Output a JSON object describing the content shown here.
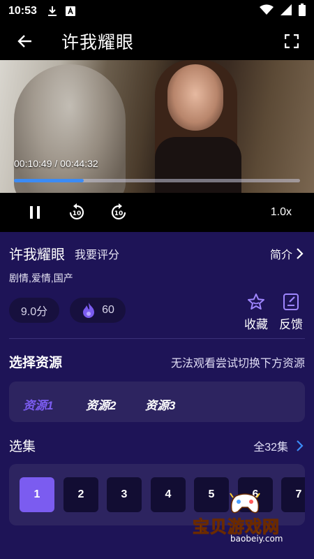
{
  "status_bar": {
    "time": "10:53"
  },
  "header": {
    "title": "许我耀眼"
  },
  "player": {
    "time_text": "00:10:49 / 00:44:32",
    "progress": 0.243,
    "speed": "1.0x"
  },
  "details": {
    "title": "许我耀眼",
    "rate_label": "我要评分",
    "intro_label": "简介",
    "genres": "剧情,爱情,国产",
    "score": "9.0分",
    "heat": "60",
    "favorite_label": "收藏",
    "feedback_label": "反馈"
  },
  "sources": {
    "title": "选择资源",
    "hint": "无法观看尝试切换下方资源",
    "items": [
      "资源1",
      "资源2",
      "资源3"
    ],
    "active_index": 0
  },
  "episodes": {
    "title": "选集",
    "total_label": "全32集",
    "items": [
      "1",
      "2",
      "3",
      "4",
      "5",
      "6",
      "7"
    ],
    "active_index": 0
  },
  "watermark": {
    "text": "宝贝游戏网",
    "url": "baobeiy.com"
  },
  "colors": {
    "accent": "#7b5cf0",
    "background": "#1e1457",
    "progress": "#3b8bf5"
  }
}
